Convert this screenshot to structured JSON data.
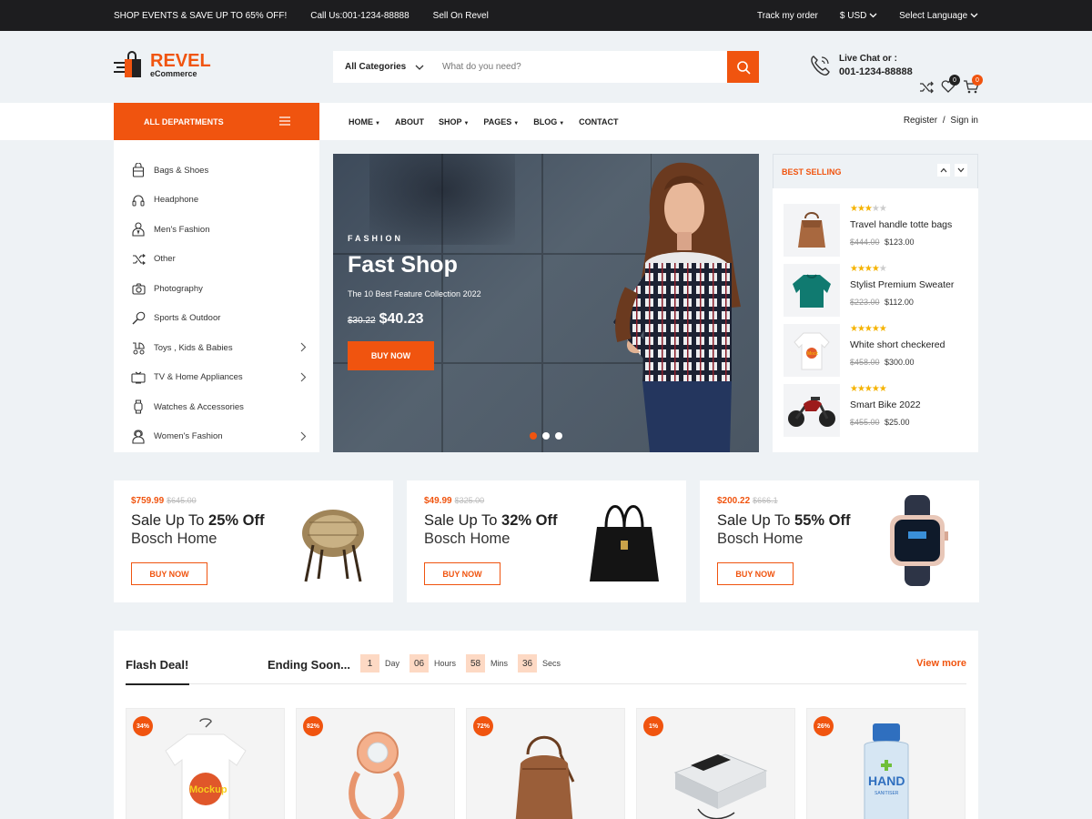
{
  "topbar": {
    "promo": "SHOP EVENTS & SAVE UP TO 65% OFF!",
    "call": "Call Us:001-1234-88888",
    "sell": "Sell On Revel",
    "track": "Track my order",
    "currency": "$ USD",
    "language": "Select Language"
  },
  "brand": {
    "name": "REVEL",
    "sub": "eCommerce",
    "accent": "#f0540f"
  },
  "search": {
    "category": "All Categories",
    "placeholder": "What do you need?"
  },
  "contact": {
    "label": "Live Chat or :",
    "phone": "001-1234-88888"
  },
  "header_icons": {
    "wishlist_count": "0",
    "cart_count": "0"
  },
  "nav": {
    "all_departments": "ALL DEPARTMENTS",
    "links": [
      "HOME",
      "ABOUT",
      "SHOP",
      "PAGES",
      "BLOG",
      "CONTACT"
    ],
    "register": "Register",
    "separator": "/",
    "signin": "Sign in"
  },
  "sidebar": {
    "items": [
      {
        "label": "Bags & Shoes",
        "icon": "bag-icon"
      },
      {
        "label": "Headphone",
        "icon": "headphone-icon"
      },
      {
        "label": "Men's Fashion",
        "icon": "man-icon"
      },
      {
        "label": "Other",
        "icon": "shuffle-icon"
      },
      {
        "label": "Photography",
        "icon": "camera-icon"
      },
      {
        "label": "Sports & Outdoor",
        "icon": "racket-icon"
      },
      {
        "label": "Toys , Kids & Babies",
        "icon": "stroller-icon"
      },
      {
        "label": "TV & Home Appliances",
        "icon": "tv-icon"
      },
      {
        "label": "Watches & Accessories",
        "icon": "watch-icon"
      },
      {
        "label": "Women's Fashion",
        "icon": "woman-icon"
      }
    ]
  },
  "hero": {
    "kicker": "FASHION",
    "title": "Fast Shop",
    "subtitle": "The 10 Best Feature Collection 2022",
    "old_price": "$30.22",
    "price": "$40.23",
    "button": "BUY NOW"
  },
  "best_selling": {
    "title": "BEST SELLING",
    "items": [
      {
        "name": "Travel handle totte bags",
        "rating": 3,
        "old": "$444.00",
        "price": "$123.00"
      },
      {
        "name": "Stylist Premium Sweater",
        "rating": 4,
        "old": "$223.00",
        "price": "$112.00"
      },
      {
        "name": "White short checkered",
        "rating": 5,
        "old": "$458.00",
        "price": "$300.00"
      },
      {
        "name": "Smart Bike 2022",
        "rating": 5,
        "old": "$455.00",
        "price": "$25.00"
      }
    ]
  },
  "promos": [
    {
      "price": "$759.99",
      "old": "$645.00",
      "prefix": "Sale Up To",
      "off": "25% Off",
      "line2": "Bosch Home",
      "button": "BUY NOW"
    },
    {
      "price": "$49.99",
      "old": "$325.00",
      "prefix": "Sale Up To",
      "off": "32% Off",
      "line2": "Bosch Home",
      "button": "BUY NOW"
    },
    {
      "price": "$200.22",
      "old": "$666.1",
      "prefix": "Sale Up To",
      "off": "55% Off",
      "line2": "Bosch Home",
      "button": "BUY NOW"
    }
  ],
  "flash": {
    "title": "Flash Deal!",
    "ending": "Ending Soon...",
    "countdown": [
      {
        "value": "1",
        "unit": "Day"
      },
      {
        "value": "06",
        "unit": "Hours"
      },
      {
        "value": "58",
        "unit": "Mins"
      },
      {
        "value": "36",
        "unit": "Secs"
      }
    ],
    "view_more": "View more",
    "products": [
      {
        "discount": "34%",
        "kind": "tshirt"
      },
      {
        "discount": "82%",
        "kind": "ring"
      },
      {
        "discount": "72%",
        "kind": "bag"
      },
      {
        "discount": "1%",
        "kind": "device"
      },
      {
        "discount": "26%",
        "kind": "sanitizer"
      }
    ],
    "sanitizer_label": "HAND",
    "sanitizer_sub": "SANITISER"
  }
}
